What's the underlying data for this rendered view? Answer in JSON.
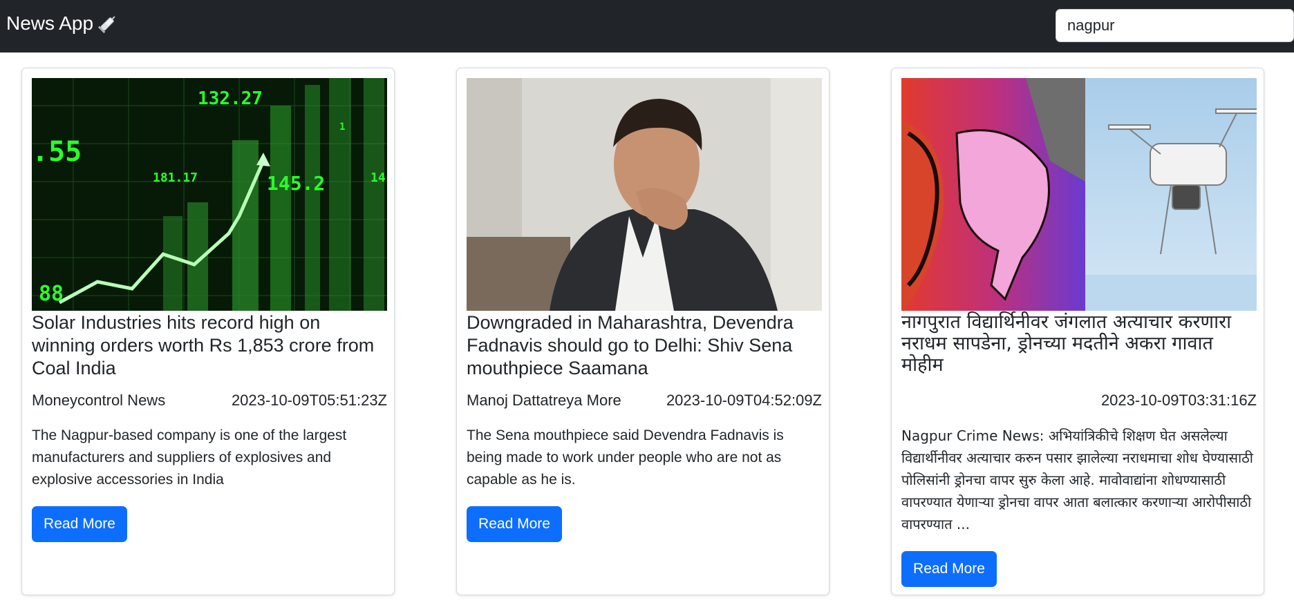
{
  "navbar": {
    "brand": "News App",
    "brand_icon": "syringe-icon",
    "search": {
      "value": "nagpur"
    }
  },
  "colors": {
    "navbar_bg": "#212529",
    "accent": "#0d6efd"
  },
  "articles": [
    {
      "title": "Solar Industries hits record high on winning orders worth Rs 1,853 crore from Coal India",
      "author": "Moneycontrol News",
      "published": "2023-10-09T05:51:23Z",
      "description": "The Nagpur-based company is one of the largest manufacturers and suppliers of explosives and explosive accessories in India",
      "button": "Read More"
    },
    {
      "title": "Downgraded in Maharashtra, Devendra Fadnavis should go to Delhi: Shiv Sena mouthpiece Saamana",
      "author": "Manoj Dattatreya More",
      "published": "2023-10-09T04:52:09Z",
      "description": "The Sena mouthpiece said Devendra Fadnavis is being made to work under people who are not as capable as he is.",
      "button": "Read More"
    },
    {
      "title": "नागपुरात विद्यार्थिनीवर जंगलात अत्याचार करणारा नराधम सापडेना, ड्रोनच्या मदतीने अकरा गावात मोहीम",
      "author": "",
      "published": "2023-10-09T03:31:16Z",
      "description": "Nagpur Crime News: अभियांत्रिकीचे शिक्षण घेत असलेल्या विद्यार्थीनीवर अत्याचार करुन पसार झालेल्या नराधमाचा शोध घेण्यासाठी पोलिसांनी ड्रोनचा वापर सुरु केला आहे. मावोवाद्यांना शोधण्यासाठी वापरण्यात येणाऱ्या ड्रोनचा वापर आता बलात्कार करणाऱ्या आरोपीसाठी वापरण्यात ...",
      "button": "Read More"
    }
  ]
}
